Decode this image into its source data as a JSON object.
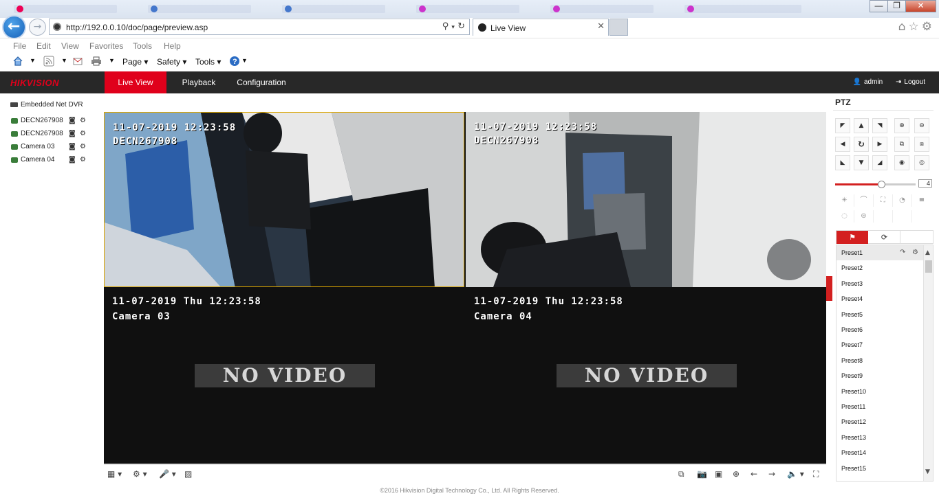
{
  "browser": {
    "url": "http://192.0.0.10/doc/page/preview.asp",
    "tab_title": "Live View",
    "menu": [
      "File",
      "Edit",
      "View",
      "Favorites",
      "Tools",
      "Help"
    ],
    "commands": {
      "page": "Page ▾",
      "safety": "Safety ▾",
      "tools": "Tools ▾"
    },
    "window_controls": {
      "minimize": "—",
      "restore": "❐",
      "close": "✕"
    }
  },
  "header": {
    "logo": "HIKVISION",
    "tabs": [
      "Live View",
      "Playback",
      "Configuration"
    ],
    "active_tab": "Live View",
    "user": "admin",
    "logout": "Logout"
  },
  "tree": {
    "root": "Embedded Net DVR",
    "cameras": [
      "DECN267908",
      "DECN267908",
      "Camera 03",
      "Camera 04"
    ]
  },
  "panes": [
    {
      "timestamp": "11-07-2019 12:23:58",
      "name": "DECN267908",
      "no_video": ""
    },
    {
      "timestamp": "11-07-2019 12:23:58",
      "name": "DECN267908",
      "no_video": ""
    },
    {
      "timestamp": "11-07-2019 Thu 12:23:58",
      "name": "Camera 03",
      "no_video": "NO VIDEO"
    },
    {
      "timestamp": "11-07-2019 Thu 12:23:58",
      "name": "Camera 04",
      "no_video": "NO VIDEO"
    }
  ],
  "ptz": {
    "title": "PTZ",
    "speed": 4,
    "speed_max": 7,
    "presets": [
      "Preset1",
      "Preset2",
      "Preset3",
      "Preset4",
      "Preset5",
      "Preset6",
      "Preset7",
      "Preset8",
      "Preset9",
      "Preset10",
      "Preset11",
      "Preset12",
      "Preset13",
      "Preset14",
      "Preset15"
    ]
  },
  "footer": "©2016 Hikvision Digital Technology Co., Ltd. All Rights Reserved.",
  "colors": {
    "accent": "#e0001b",
    "header_bg": "#282828",
    "selected_border": "#d9a400"
  }
}
